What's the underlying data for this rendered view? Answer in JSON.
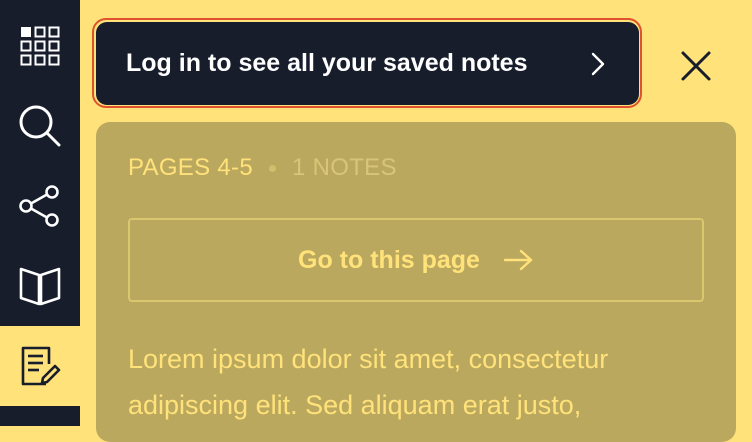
{
  "sidebar": {
    "items": [
      {
        "icon": "grid-icon",
        "active": false
      },
      {
        "icon": "search-icon",
        "active": false
      },
      {
        "icon": "share-icon",
        "active": false
      },
      {
        "icon": "book-icon",
        "active": false
      },
      {
        "icon": "notes-edit-icon",
        "active": true
      }
    ]
  },
  "login_banner": {
    "label": "Log in to see all your saved notes",
    "chevron_icon": "chevron-right-icon"
  },
  "close_icon": "close-icon",
  "note": {
    "pages": "PAGES 4-5",
    "count": "1 NOTES",
    "goto_label": "Go to this page",
    "goto_icon": "arrow-right-icon",
    "text_line1": "Lorem ipsum dolor sit amet, consectetur",
    "text_line2": "adipiscing elit. Sed aliquam erat justo,"
  },
  "colors": {
    "sidebar_bg": "#171d2b",
    "accent_yellow": "#ffe27a",
    "card_bg": "#bba85f",
    "highlight_border": "#e0522d"
  }
}
